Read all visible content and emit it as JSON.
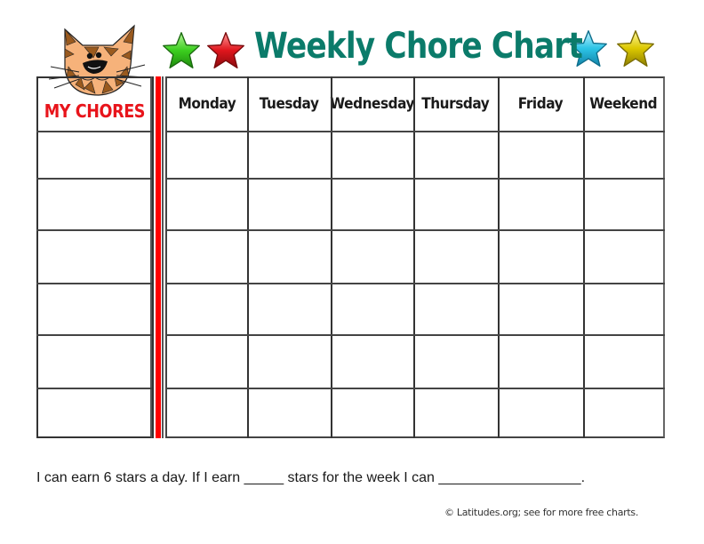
{
  "header": {
    "title": "Weekly Chore Chart",
    "stars_left": [
      {
        "icon": "green-star-icon",
        "color": "#2fbf1a"
      },
      {
        "icon": "red-star-icon",
        "color": "#d01018"
      }
    ],
    "stars_right": [
      {
        "icon": "blue-star-icon",
        "color": "#22b8d8"
      },
      {
        "icon": "yellow-star-icon",
        "color": "#d8c200"
      }
    ],
    "mascot_icon": "cat-face-icon"
  },
  "table": {
    "chores_label": "MY CHORES",
    "days": [
      "Monday",
      "Tuesday",
      "Wednesday",
      "Thursday",
      "Friday",
      "Weekend"
    ],
    "rows": [
      {
        "chore": "",
        "cells": [
          "",
          "",
          "",
          "",
          "",
          ""
        ]
      },
      {
        "chore": "",
        "cells": [
          "",
          "",
          "",
          "",
          "",
          ""
        ]
      },
      {
        "chore": "",
        "cells": [
          "",
          "",
          "",
          "",
          "",
          ""
        ]
      },
      {
        "chore": "",
        "cells": [
          "",
          "",
          "",
          "",
          "",
          ""
        ]
      },
      {
        "chore": "",
        "cells": [
          "",
          "",
          "",
          "",
          "",
          ""
        ]
      },
      {
        "chore": "",
        "cells": [
          "",
          "",
          "",
          "",
          "",
          ""
        ]
      }
    ]
  },
  "colors": {
    "title": "#0b7b6a",
    "chores_label": "#e8141b",
    "divider_bar": "#ff0000",
    "grid": "#333333"
  },
  "footer": {
    "pledge": "I can earn 6 stars a day. If I earn _____ stars for the week I can __________________.",
    "copyright": "© Latitudes.org; see for more free charts."
  }
}
